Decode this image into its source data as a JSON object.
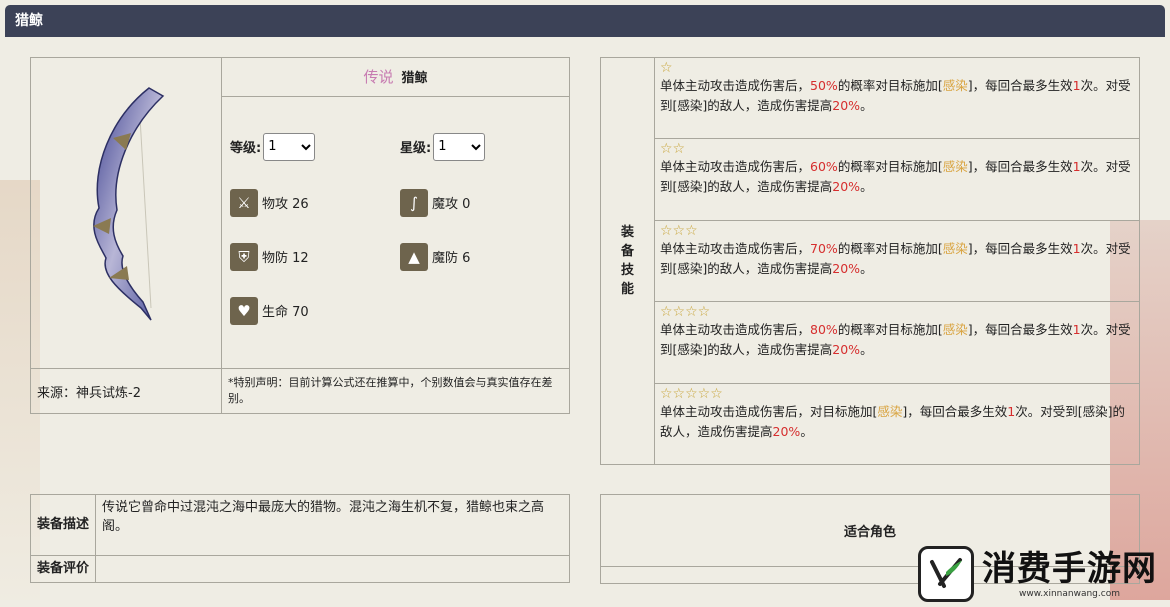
{
  "header": {
    "title": "猎鲸"
  },
  "equipment": {
    "rarity": "传说",
    "name": "猎鲸",
    "level_label": "等级:",
    "level_value": "1",
    "star_label": "星级:",
    "star_value": "1",
    "stats": [
      {
        "label": "物攻 26",
        "icon": "sword-icon"
      },
      {
        "label": "魔攻 0",
        "icon": "staff-icon"
      },
      {
        "label": "物防 12",
        "icon": "shield-icon"
      },
      {
        "label": "魔防 6",
        "icon": "wizard-hat-icon"
      },
      {
        "label": "生命 70",
        "icon": "heart-icon"
      }
    ],
    "source": "来源：神兵试炼-2",
    "note": "*特别声明：目前计算公式还在推算中，个别数值会与真实值存在差别。"
  },
  "skills": {
    "label": "装备技能",
    "tiers": [
      {
        "stars": 1,
        "p1": "单体主动攻击造成伤害后，",
        "chance": "50%",
        "p2": "的概率对目标施加[",
        "effect": "感染",
        "p3": "]，每回合最多生效",
        "times": "1",
        "p4": "次。对受到[感染]的敌人，造成伤害提高",
        "boost": "20%",
        "p5": "。"
      },
      {
        "stars": 2,
        "p1": "单体主动攻击造成伤害后，",
        "chance": "60%",
        "p2": "的概率对目标施加[",
        "effect": "感染",
        "p3": "]，每回合最多生效",
        "times": "1",
        "p4": "次。对受到[感染]的敌人，造成伤害提高",
        "boost": "20%",
        "p5": "。"
      },
      {
        "stars": 3,
        "p1": "单体主动攻击造成伤害后，",
        "chance": "70%",
        "p2": "的概率对目标施加[",
        "effect": "感染",
        "p3": "]，每回合最多生效",
        "times": "1",
        "p4": "次。对受到[感染]的敌人，造成伤害提高",
        "boost": "20%",
        "p5": "。"
      },
      {
        "stars": 4,
        "p1": "单体主动攻击造成伤害后，",
        "chance": "80%",
        "p2": "的概率对目标施加[",
        "effect": "感染",
        "p3": "]，每回合最多生效",
        "times": "1",
        "p4": "次。对受到[感染]的敌人，造成伤害提高",
        "boost": "20%",
        "p5": "。"
      },
      {
        "stars": 5,
        "p1": "单体主动攻击造成伤害后，对目标施加[",
        "chance": "",
        "p2": "",
        "effect": "感染",
        "p3": "]，每回合最多生效",
        "times": "1",
        "p4": "次。对受到[感染]的敌人，造成伤害提高",
        "boost": "20%",
        "p5": "。"
      }
    ]
  },
  "description": {
    "desc_label": "装备描述",
    "desc_text": "传说它曾命中过混沌之海中最庞大的猎物。混沌之海生机不复，猎鲸也束之高阁。",
    "eval_label": "装备评价",
    "eval_text": ""
  },
  "roles": {
    "title": "适合角色"
  },
  "watermark": {
    "text": "消费手游网",
    "url": "www.xinnanwang.com"
  },
  "colors": {
    "header_bg": "#3c4257",
    "highlight_red": "#d62e2e",
    "highlight_gold": "#d9a441",
    "rarity": "#c77bb1"
  }
}
